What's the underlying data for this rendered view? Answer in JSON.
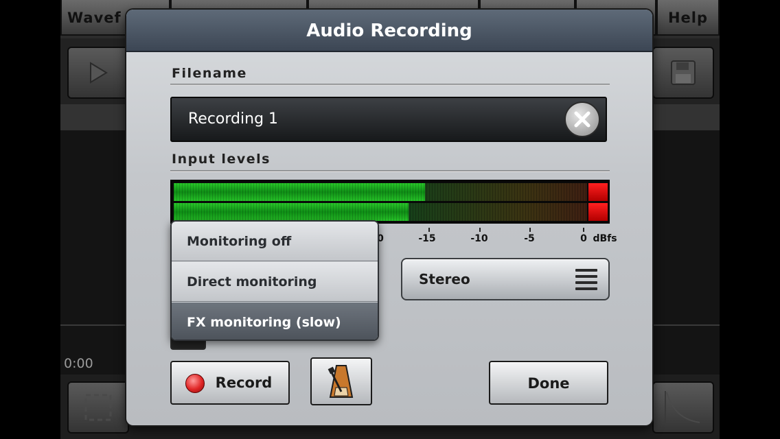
{
  "background": {
    "top_tabs": [
      {
        "label": "Wavef"
      },
      {
        "label": ""
      },
      {
        "label": ""
      },
      {
        "label": ""
      },
      {
        "label": ""
      },
      {
        "label": "Help"
      }
    ],
    "time_readout": "0:00",
    "icons": {
      "play": "play-icon",
      "save": "floppy-disk-icon",
      "select": "selection-icon",
      "fade": "fade-curve-icon"
    }
  },
  "dialog": {
    "title": "Audio Recording",
    "filename_label": "Filename",
    "filename_value": "Recording 1",
    "input_levels_label": "Input levels",
    "meter": {
      "left_level": 0.61,
      "right_level": 0.57,
      "peak_color": "#ff1a1a",
      "fill_color": "#1fb424"
    },
    "scale": [
      {
        "label": "0"
      },
      {
        "label": "-15"
      },
      {
        "label": "-10"
      },
      {
        "label": "-5"
      },
      {
        "label": "0"
      },
      {
        "label": "dBfs"
      }
    ],
    "channel_select": "Stereo",
    "record_button": "Record",
    "metronome_icon": "metronome-icon",
    "done_button": "Done"
  },
  "monitor_menu": {
    "items": [
      {
        "label": "Monitoring off",
        "selected": false
      },
      {
        "label": "Direct monitoring",
        "selected": false
      },
      {
        "label": "FX monitoring (slow)",
        "selected": true
      }
    ]
  }
}
